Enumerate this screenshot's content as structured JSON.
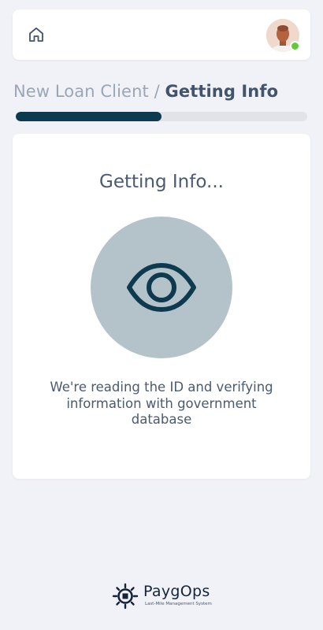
{
  "header": {
    "home_icon": "home-icon",
    "avatar_status": "online",
    "accent_status_color": "#62c93a"
  },
  "breadcrumb": {
    "parent": "New Loan Client",
    "separator": " / ",
    "current": "Getting Info"
  },
  "progress": {
    "fraction": 0.5,
    "fill_color": "#0e3a50"
  },
  "card": {
    "title": "Getting Info...",
    "icon": "eye-icon",
    "description": "We're reading the ID and verifying information with government database"
  },
  "footer": {
    "brand_name": "PaygOps",
    "tagline": "Last-Mile Management System"
  }
}
